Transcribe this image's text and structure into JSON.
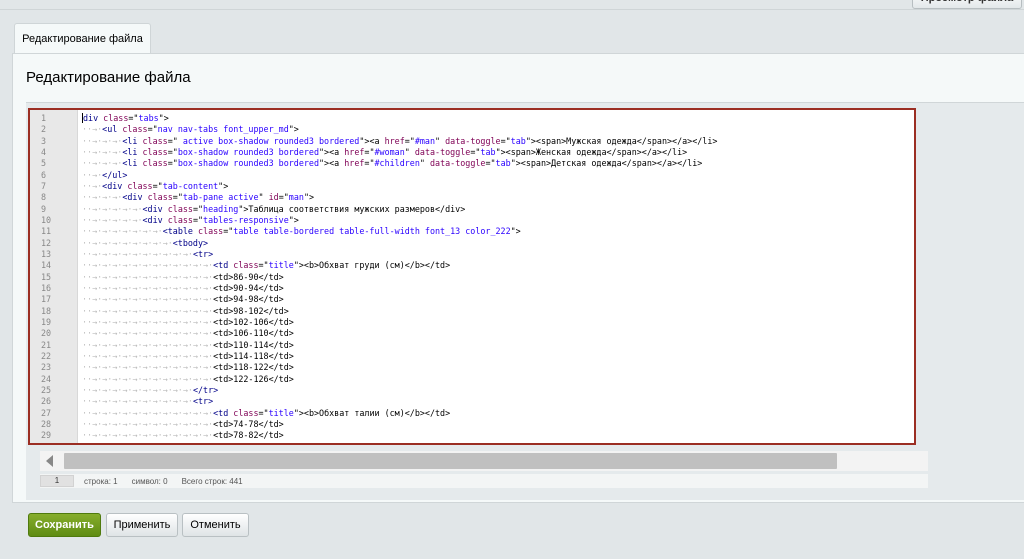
{
  "header": {
    "preview_label": "Просмотр файла"
  },
  "tab": {
    "label": "Редактирование файла"
  },
  "page": {
    "title": "Редактирование файла"
  },
  "editor": {
    "lines": [
      {
        "n": "1",
        "ind": "",
        "parts": [
          [
            "tag",
            "div "
          ],
          [
            "attr",
            "class"
          ],
          [
            "t",
            "=\""
          ],
          [
            "str",
            "tabs"
          ],
          [
            "t",
            "\">"
          ]
        ]
      },
      {
        "n": "2",
        "ind": "··→·",
        "parts": [
          [
            "tag",
            "<ul "
          ],
          [
            "attr",
            "class"
          ],
          [
            "t",
            "=\""
          ],
          [
            "str",
            "nav nav-tabs font_upper_md"
          ],
          [
            "t",
            "\">"
          ]
        ]
      },
      {
        "n": "3",
        "ind": "··→·→·→·",
        "parts": [
          [
            "tag",
            "<li "
          ],
          [
            "attr",
            "class"
          ],
          [
            "t",
            "=\""
          ],
          [
            "str",
            " active box-shadow rounded3 bordered"
          ],
          [
            "t",
            "\"><a "
          ],
          [
            "attr",
            "href"
          ],
          [
            "t",
            "=\""
          ],
          [
            "str",
            "#man"
          ],
          [
            "t",
            "\" "
          ],
          [
            "attr",
            "data-toggle"
          ],
          [
            "t",
            "=\""
          ],
          [
            "str",
            "tab"
          ],
          [
            "t",
            "\"><span>Мужская одежда</span></a></li>"
          ]
        ]
      },
      {
        "n": "4",
        "ind": "··→·→·→·",
        "parts": [
          [
            "tag",
            "<li "
          ],
          [
            "attr",
            "class"
          ],
          [
            "t",
            "=\""
          ],
          [
            "str",
            "box-shadow rounded3 bordered"
          ],
          [
            "t",
            "\"><a "
          ],
          [
            "attr",
            "href"
          ],
          [
            "t",
            "=\""
          ],
          [
            "str",
            "#woman"
          ],
          [
            "t",
            "\" "
          ],
          [
            "attr",
            "data-toggle"
          ],
          [
            "t",
            "=\""
          ],
          [
            "str",
            "tab"
          ],
          [
            "t",
            "\"><span>Женская одежда</span></a></li>"
          ]
        ]
      },
      {
        "n": "5",
        "ind": "··→·→·→·",
        "parts": [
          [
            "tag",
            "<li "
          ],
          [
            "attr",
            "class"
          ],
          [
            "t",
            "=\""
          ],
          [
            "str",
            "box-shadow rounded3 bordered"
          ],
          [
            "t",
            "\"><a "
          ],
          [
            "attr",
            "href"
          ],
          [
            "t",
            "=\""
          ],
          [
            "str",
            "#children"
          ],
          [
            "t",
            "\" "
          ],
          [
            "attr",
            "data-toggle"
          ],
          [
            "t",
            "=\""
          ],
          [
            "str",
            "tab"
          ],
          [
            "t",
            "\"><span>Детская одежда</span></a></li>"
          ]
        ]
      },
      {
        "n": "6",
        "ind": "··→·",
        "parts": [
          [
            "tag",
            "</ul>"
          ]
        ]
      },
      {
        "n": "7",
        "ind": "··→·",
        "parts": [
          [
            "tag",
            "<div "
          ],
          [
            "attr",
            "class"
          ],
          [
            "t",
            "=\""
          ],
          [
            "str",
            "tab-content"
          ],
          [
            "t",
            "\">"
          ]
        ]
      },
      {
        "n": "8",
        "ind": "··→·→·→·",
        "parts": [
          [
            "tag",
            "<div "
          ],
          [
            "attr",
            "class"
          ],
          [
            "t",
            "=\""
          ],
          [
            "str",
            "tab-pane active"
          ],
          [
            "t",
            "\" "
          ],
          [
            "attr",
            "id"
          ],
          [
            "t",
            "=\""
          ],
          [
            "str",
            "man"
          ],
          [
            "t",
            "\">"
          ]
        ]
      },
      {
        "n": "9",
        "ind": "··→·→·→·→·→·",
        "parts": [
          [
            "tag",
            "<div "
          ],
          [
            "attr",
            "class"
          ],
          [
            "t",
            "=\""
          ],
          [
            "str",
            "heading"
          ],
          [
            "t",
            "\">Таблица соответствия мужских размеров</div>"
          ]
        ]
      },
      {
        "n": "10",
        "ind": "··→·→·→·→·→·",
        "parts": [
          [
            "tag",
            "<div "
          ],
          [
            "attr",
            "class"
          ],
          [
            "t",
            "=\""
          ],
          [
            "str",
            "tables-responsive"
          ],
          [
            "t",
            "\">"
          ]
        ]
      },
      {
        "n": "11",
        "ind": "··→·→·→·→·→·→·→·",
        "parts": [
          [
            "tag",
            "<table "
          ],
          [
            "attr",
            "class"
          ],
          [
            "t",
            "=\""
          ],
          [
            "str",
            "table table-bordered table-full-width font_13 color_222"
          ],
          [
            "t",
            "\">"
          ]
        ]
      },
      {
        "n": "12",
        "ind": "··→·→·→·→·→·→·→·→·",
        "parts": [
          [
            "tag",
            "<tbody>"
          ]
        ]
      },
      {
        "n": "13",
        "ind": "··→·→·→·→·→·→·→·→·→·→·",
        "parts": [
          [
            "tag",
            "<tr>"
          ]
        ]
      },
      {
        "n": "14",
        "ind": "··→·→·→·→·→·→·→·→·→·→·→·→·",
        "parts": [
          [
            "tag",
            "<td "
          ],
          [
            "attr",
            "class"
          ],
          [
            "t",
            "=\""
          ],
          [
            "str",
            "title"
          ],
          [
            "t",
            "\"><b>Обхват груди (см)</b></td>"
          ]
        ]
      },
      {
        "n": "15",
        "ind": "··→·→·→·→·→·→·→·→·→·→·→·→·",
        "parts": [
          [
            "t",
            "<td>86-90</td>"
          ]
        ]
      },
      {
        "n": "16",
        "ind": "··→·→·→·→·→·→·→·→·→·→·→·→·",
        "parts": [
          [
            "t",
            "<td>90-94</td>"
          ]
        ]
      },
      {
        "n": "17",
        "ind": "··→·→·→·→·→·→·→·→·→·→·→·→·",
        "parts": [
          [
            "t",
            "<td>94-98</td>"
          ]
        ]
      },
      {
        "n": "18",
        "ind": "··→·→·→·→·→·→·→·→·→·→·→·→·",
        "parts": [
          [
            "t",
            "<td>98-102</td>"
          ]
        ]
      },
      {
        "n": "19",
        "ind": "··→·→·→·→·→·→·→·→·→·→·→·→·",
        "parts": [
          [
            "t",
            "<td>102-106</td>"
          ]
        ]
      },
      {
        "n": "20",
        "ind": "··→·→·→·→·→·→·→·→·→·→·→·→·",
        "parts": [
          [
            "t",
            "<td>106-110</td>"
          ]
        ]
      },
      {
        "n": "21",
        "ind": "··→·→·→·→·→·→·→·→·→·→·→·→·",
        "parts": [
          [
            "t",
            "<td>110-114</td>"
          ]
        ]
      },
      {
        "n": "22",
        "ind": "··→·→·→·→·→·→·→·→·→·→·→·→·",
        "parts": [
          [
            "t",
            "<td>114-118</td>"
          ]
        ]
      },
      {
        "n": "23",
        "ind": "··→·→·→·→·→·→·→·→·→·→·→·→·",
        "parts": [
          [
            "t",
            "<td>118-122</td>"
          ]
        ]
      },
      {
        "n": "24",
        "ind": "··→·→·→·→·→·→·→·→·→·→·→·→·",
        "parts": [
          [
            "t",
            "<td>122-126</td>"
          ]
        ]
      },
      {
        "n": "25",
        "ind": "··→·→·→·→·→·→·→·→·→·→·",
        "parts": [
          [
            "tag",
            "</tr>"
          ]
        ]
      },
      {
        "n": "26",
        "ind": "··→·→·→·→·→·→·→·→·→·→·",
        "parts": [
          [
            "tag",
            "<tr>"
          ]
        ]
      },
      {
        "n": "27",
        "ind": "··→·→·→·→·→·→·→·→·→·→·→·→·",
        "parts": [
          [
            "tag",
            "<td "
          ],
          [
            "attr",
            "class"
          ],
          [
            "t",
            "=\""
          ],
          [
            "str",
            "title"
          ],
          [
            "t",
            "\"><b>Обхват талии (см)</b></td>"
          ]
        ]
      },
      {
        "n": "28",
        "ind": "··→·→·→·→·→·→·→·→·→·→·→·→·",
        "parts": [
          [
            "t",
            "<td>74-78</td>"
          ]
        ]
      },
      {
        "n": "29",
        "ind": "··→·→·→·→·→·→·→·→·→·→·→·→·",
        "parts": [
          [
            "t",
            "<td>78-82</td>"
          ]
        ]
      }
    ]
  },
  "statusbar": {
    "current_line": "1",
    "position": "строка: 1",
    "symbol": "символ: 0",
    "total": "Всего строк: 441"
  },
  "buttons": {
    "save": "Сохранить",
    "apply": "Применить",
    "cancel": "Отменить"
  },
  "colors": {
    "frame": "#9b2e23",
    "save_button": "#6f9b1c"
  }
}
